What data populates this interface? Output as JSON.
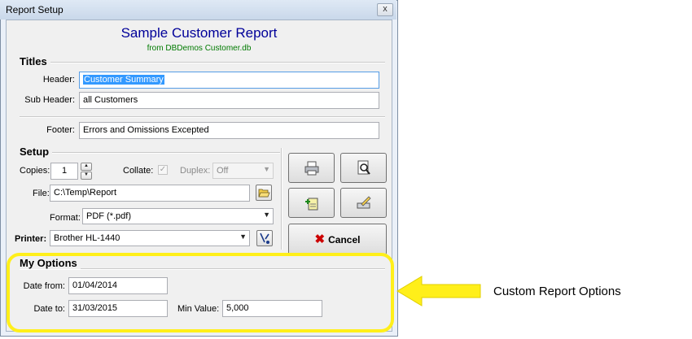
{
  "window": {
    "title": "Report Setup",
    "close_glyph": "x"
  },
  "report": {
    "title": "Sample Customer Report",
    "subtitle": "from DBDemos Customer.db"
  },
  "titles": {
    "section_label": "Titles",
    "header_label": "Header:",
    "header_value": "Customer Summary",
    "subheader_label": "Sub Header:",
    "subheader_value": "all Customers",
    "footer_label": "Footer:",
    "footer_value": "Errors and Omissions Excepted"
  },
  "setup": {
    "section_label": "Setup",
    "copies_label": "Copies:",
    "copies_value": "1",
    "collate_label": "Collate:",
    "collate_checked": true,
    "duplex_label": "Duplex:",
    "duplex_value": "Off",
    "file_label": "File:",
    "file_value": "C:\\Temp\\Report",
    "format_label": "Format:",
    "format_value": "PDF (*.pdf)",
    "printer_label": "Printer:",
    "printer_value": "Brother HL-1440"
  },
  "actions": {
    "print_icon": "printer-icon",
    "preview_icon": "print-preview-icon",
    "export_icon": "export-icon",
    "edit_icon": "edit-icon",
    "cancel_label": "Cancel"
  },
  "my_options": {
    "section_label": "My Options",
    "date_from_label": "Date from:",
    "date_from_value": "01/04/2014",
    "date_to_label": "Date to:",
    "date_to_value": "31/03/2015",
    "min_value_label": "Min Value:",
    "min_value_value": "5,000"
  },
  "annotation": {
    "text": "Custom Report Options",
    "color": "#ffef1a"
  },
  "colors": {
    "title_blue": "#000099",
    "subtitle_green": "#007a00",
    "cancel_red": "#cc0000"
  }
}
